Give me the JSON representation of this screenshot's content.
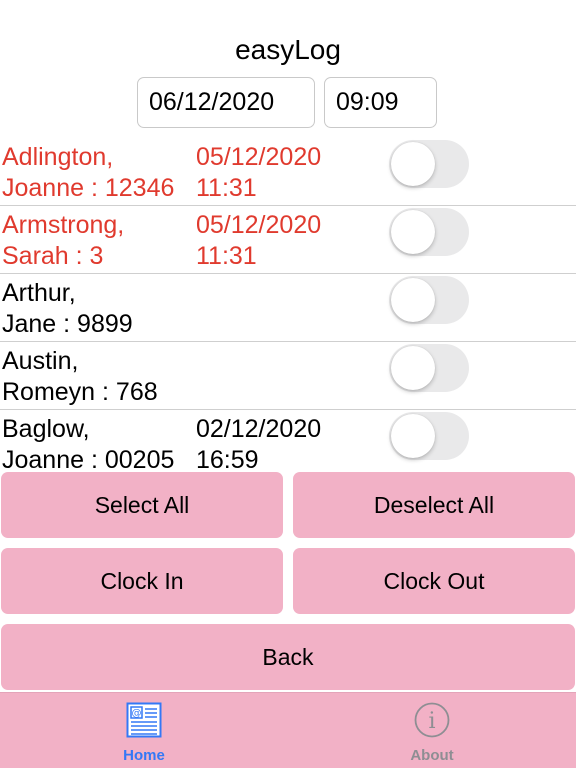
{
  "app": {
    "title": "easyLog"
  },
  "datetime": {
    "date": "06/12/2020",
    "time": "09:09"
  },
  "people": [
    {
      "name": "Adlington,\nJoanne : 12346",
      "last_clock": "05/12/2020\n11:31",
      "flagged": true,
      "selected": false
    },
    {
      "name": "Armstrong,\nSarah : 3",
      "last_clock": "05/12/2020\n11:31",
      "flagged": true,
      "selected": false
    },
    {
      "name": "Arthur,\nJane : 9899",
      "last_clock": "",
      "flagged": false,
      "selected": false
    },
    {
      "name": "Austin,\nRomeyn : 768",
      "last_clock": "",
      "flagged": false,
      "selected": false
    },
    {
      "name": "Baglow,\nJoanne : 00205",
      "last_clock": "02/12/2020\n16:59",
      "flagged": false,
      "selected": false
    }
  ],
  "buttons": {
    "select_all": "Select All",
    "deselect_all": "Deselect All",
    "clock_in": "Clock In",
    "clock_out": "Clock Out",
    "back": "Back"
  },
  "tabs": [
    {
      "label": "Home",
      "icon": "home-news-icon",
      "active": true
    },
    {
      "label": "About",
      "icon": "info-circle-icon",
      "active": false
    }
  ],
  "colors": {
    "accent_pink": "#f2b1c6",
    "flagged_red": "#e03a2e",
    "tab_active": "#3478f6",
    "tab_inactive": "#8e8e93"
  }
}
